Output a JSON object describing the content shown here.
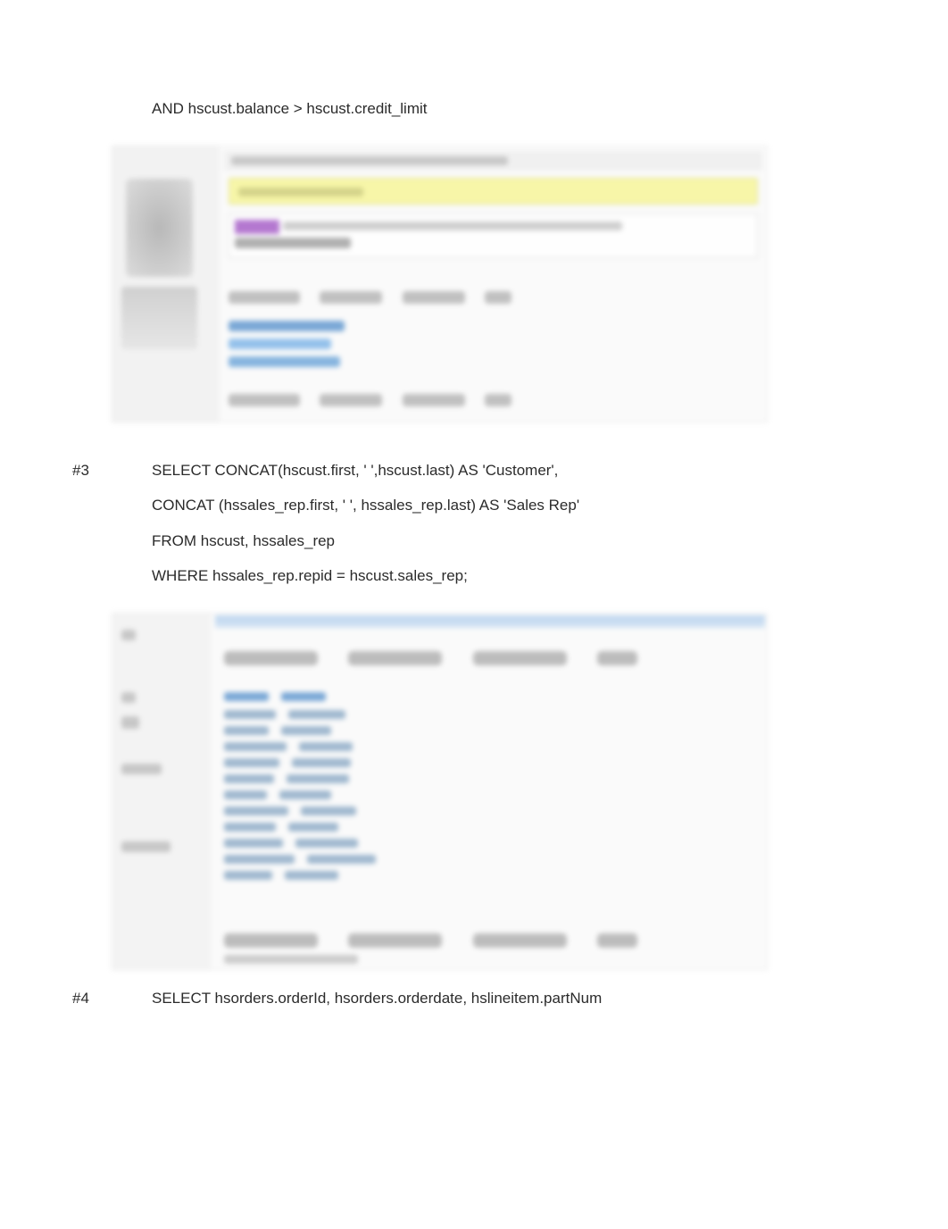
{
  "fragment_top": {
    "line1": "AND hscust.balance > hscust.credit_limit"
  },
  "q3": {
    "num": "#3",
    "line1": "SELECT CONCAT(hscust.first, ' ',hscust.last) AS 'Customer',",
    "line2": "CONCAT (hssales_rep.first, ' ', hssales_rep.last) AS 'Sales Rep'",
    "line3": "FROM hscust, hssales_rep",
    "line4": "WHERE hssales_rep.repid = hscust.sales_rep;"
  },
  "q4": {
    "num": "#4",
    "line1": "SELECT hsorders.orderId, hsorders.orderdate, hslineitem.partNum"
  }
}
